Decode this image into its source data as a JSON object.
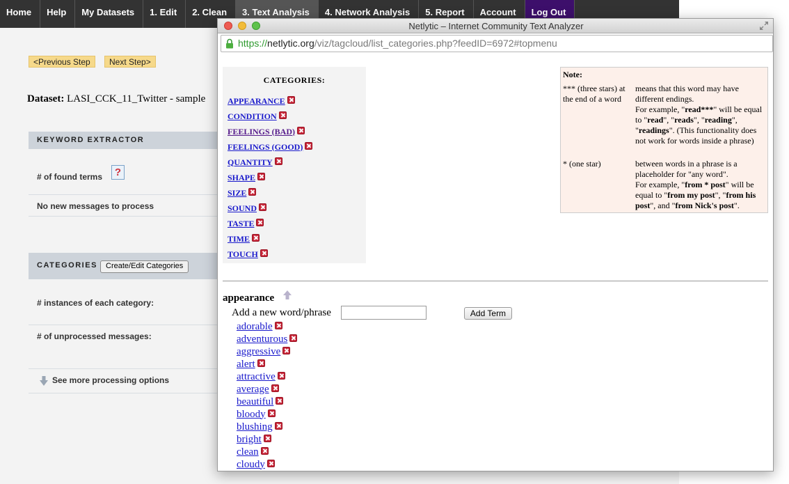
{
  "nav": {
    "items": [
      "Home",
      "Help",
      "My Datasets",
      "1. Edit",
      "2. Clean",
      "3. Text Analysis",
      "4. Network Analysis",
      "5. Report",
      "Account",
      "Log Out"
    ]
  },
  "background": {
    "prev_step": "<Previous Step",
    "next_step": "Next Step>",
    "dataset_label": "Dataset:",
    "dataset_value": "LASI_CCK_11_Twitter - sample",
    "keyword_extractor": "KEYWORD EXTRACTOR",
    "found_terms": "# of found terms",
    "no_new_messages": "No new messages to process",
    "categories": "CATEGORIES",
    "create_edit": "Create/Edit Categories",
    "instances": "# instances of each category:",
    "unprocessed": "# of unprocessed messages:",
    "see_more": "See more processing options"
  },
  "popup": {
    "title": "Netlytic – Internet Community Text Analyzer",
    "url_scheme": "https://",
    "url_host": "netlytic.org",
    "url_path": "/viz/tagcloud/list_categories.php?feedID=6972#topmenu",
    "categories_title": "CATEGORIES:",
    "categories": [
      {
        "label": "APPEARANCE",
        "visited": false
      },
      {
        "label": "CONDITION",
        "visited": false
      },
      {
        "label": "FEELINGS (BAD)",
        "visited": true
      },
      {
        "label": "FEELINGS (GOOD)",
        "visited": false
      },
      {
        "label": "QUANTITY",
        "visited": false
      },
      {
        "label": "SHAPE",
        "visited": false
      },
      {
        "label": "SIZE",
        "visited": false
      },
      {
        "label": "SOUND",
        "visited": false
      },
      {
        "label": "TASTE",
        "visited": false
      },
      {
        "label": "TIME",
        "visited": false
      },
      {
        "label": "TOUCH",
        "visited": false
      }
    ],
    "note": {
      "title": "Note:",
      "three_star_left": "*** (three stars) at the end of a word",
      "three_star_right": "means that this word may have different endings.",
      "three_star_example_prefix": "For example, \"",
      "three_star_example_read_stars": "read***",
      "three_star_example_mid": "\" will be equal to \"",
      "ex_read": "read",
      "ex_reads": "reads",
      "ex_reading": "reading",
      "ex_readings": "readings",
      "three_star_tail": "\". (This functionality does not work for words inside a phrase)",
      "one_star_left": "* (one star)",
      "one_star_right": "between words in a phrase is a placeholder for \"any word\".",
      "one_star_example_prefix": "For example, \"",
      "ex_from_post": "from * post",
      "ex_from_my_post": "from my post",
      "ex_from_his_post": "from his post",
      "ex_from_nicks_post": "from Nick's post"
    },
    "section_title": "appearance",
    "add_label": "Add a new word/phrase",
    "add_value": "",
    "add_button": "Add Term",
    "words": [
      "adorable",
      "adventurous",
      "aggressive",
      "alert",
      "attractive",
      "average",
      "beautiful",
      "bloody",
      "blushing",
      "bright",
      "clean",
      "cloudy"
    ]
  }
}
